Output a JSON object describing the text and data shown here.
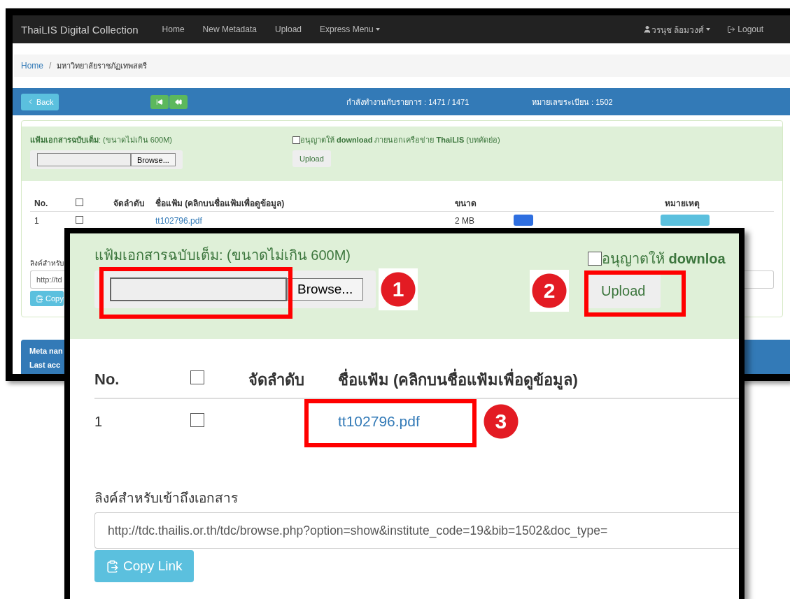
{
  "navbar": {
    "brand": "ThaiLIS Digital Collection",
    "links": [
      {
        "label": "Home",
        "dropdown": false
      },
      {
        "label": "New Metadata",
        "dropdown": false
      },
      {
        "label": "Upload",
        "dropdown": false
      },
      {
        "label": "Express Menu",
        "dropdown": true
      }
    ],
    "user": "วรนุช ล้อมวงศ์",
    "logout": "Logout"
  },
  "breadcrumb": {
    "items": [
      "Home",
      "มหาวิทยาลัยราชภัฏเทพสตรี"
    ],
    "separator": "/"
  },
  "record_bar": {
    "back": "Back",
    "status": "กำลังทำงานกับรายการ : 1471 / 1471",
    "record_no": "หมายเลขระเบียน : 1502"
  },
  "upload_panel": {
    "file_label": "**แฟ้มเอกสารฉบับเต็ม**: (ขนาดไม่เกิน 600M)",
    "browse": "Browse...",
    "allow_download": {
      "label": "อนุญาตให้ **download** ภายนอกเครือข่าย **ThaiLIS** (บทคัดย่อ)",
      "checked": false
    },
    "upload": "Upload"
  },
  "files_table": {
    "columns": [
      "No.",
      "จัดลำดับ",
      "ชื่อแฟ้ม (คลิกบนชื่อแฟ้มเพื่อดูข้อมูล)",
      "ขนาด",
      "หมายเหตุ"
    ],
    "select_all_checked": false,
    "rows": [
      {
        "no": "1",
        "checked": false,
        "file": "tt102796.pdf",
        "size": "2 MB"
      }
    ]
  },
  "link_section": {
    "label": "ลิงค์สำหรับ",
    "url": "http://td",
    "copy": "Copy"
  },
  "meta_box": [
    "Meta nan",
    "Last acc"
  ],
  "zoom_inset": {
    "file_label": "แฟ้มเอกสารฉบับเต็ม: (ขนาดไม่เกิน 600M)",
    "browse": "Browse...",
    "allow_download": {
      "label": "อนุญาตให้ **downloa**",
      "checked": false
    },
    "upload": "Upload",
    "columns": [
      "No.",
      "จัดลำดับ",
      "ชื่อแฟ้ม (คลิกบนชื่อแฟ้มเพื่อดูข้อมูล)"
    ],
    "select_all_checked": false,
    "rows": [
      {
        "no": "1",
        "checked": false,
        "file": "tt102796.pdf"
      }
    ],
    "link_label": "ลิงค์สำหรับเข้าถึงเอกสาร",
    "url": "http://tdc.thailis.or.th/tdc/browse.php?option=show&institute_code=19&bib=1502&doc_type=",
    "copy": "Copy Link",
    "callouts": [
      "1",
      "2",
      "3"
    ]
  }
}
